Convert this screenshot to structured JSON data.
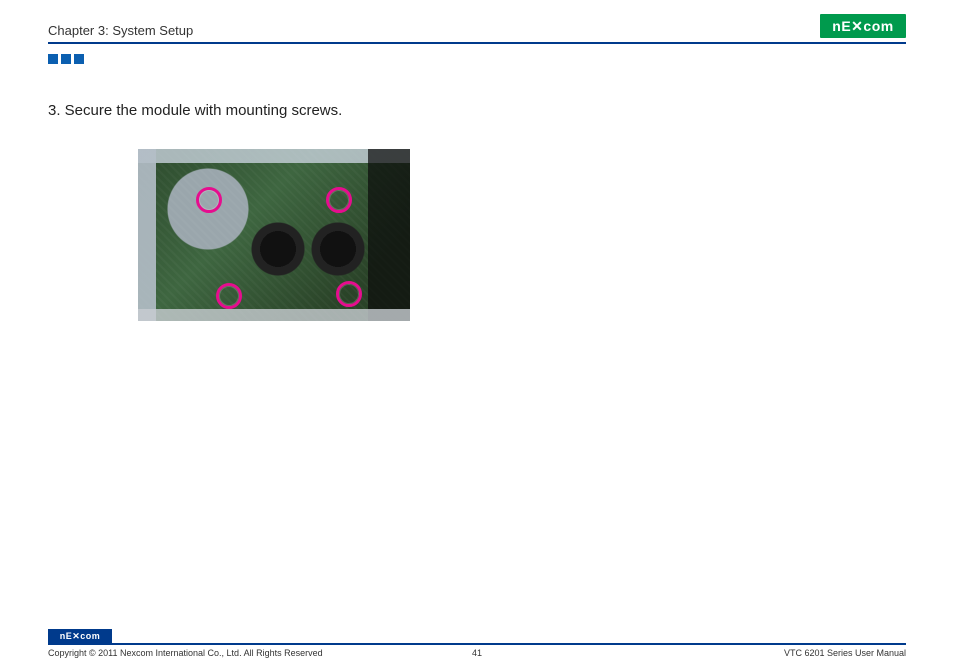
{
  "header": {
    "chapter_title": "Chapter 3: System Setup",
    "logo_text": "NE COM"
  },
  "body": {
    "instruction": "3. Secure the module with mounting screws."
  },
  "footer": {
    "logo_text": "NE COM",
    "copyright": "Copyright © 2011 Nexcom International Co., Ltd. All Rights Reserved",
    "page_number": "41",
    "manual_title": "VTC 6201 Series User Manual"
  }
}
